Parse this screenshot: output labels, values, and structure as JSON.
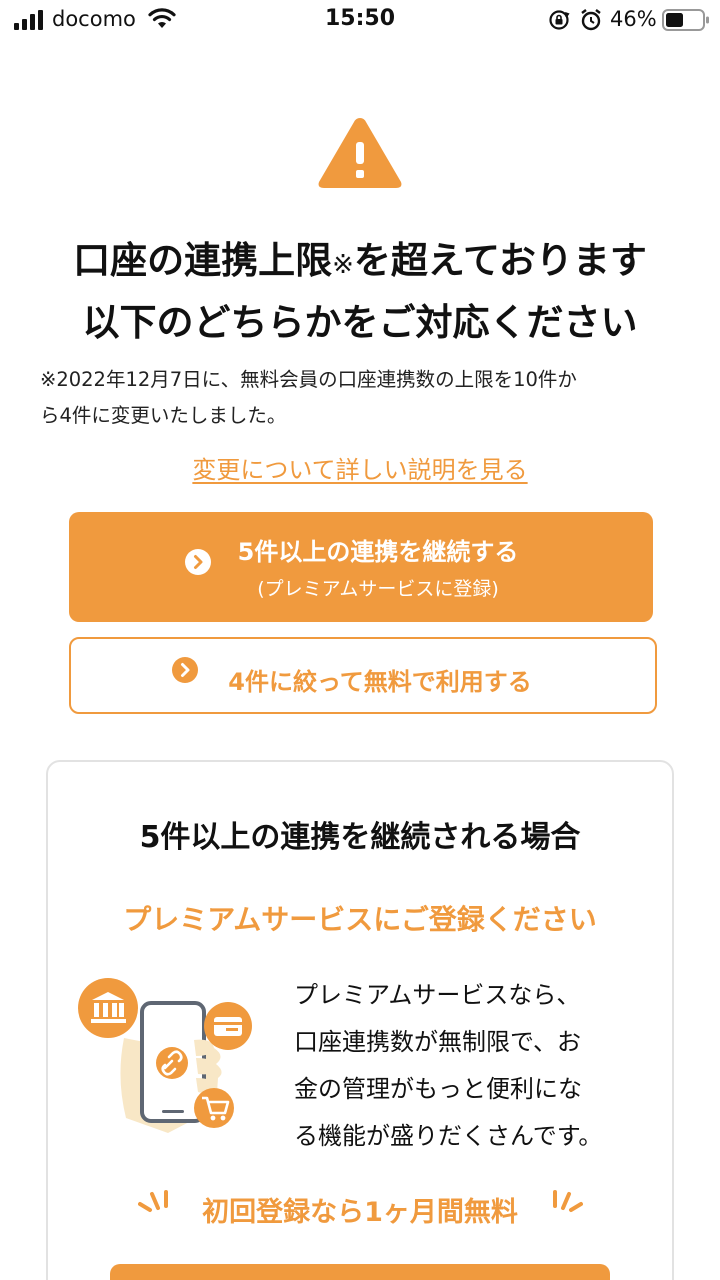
{
  "status_bar": {
    "carrier": "docomo",
    "time": "15:50",
    "battery_percent": "46%",
    "icons": [
      "signal-icon",
      "wifi-icon",
      "orientation-lock-icon",
      "alarm-icon",
      "battery-icon"
    ]
  },
  "alert": {
    "icon": "warning-icon",
    "headline_line1_a": "口座の連携上限",
    "headline_mark": "※",
    "headline_line1_b": "を超えております",
    "headline_line2": "以下のどちらかをご対応ください",
    "note_line1": "※2022年12月7日に、無料会員の口座連携数の上限を10件か",
    "note_line2": "ら4件に変更いたしました。",
    "detail_link": "変更について詳しい説明を見る"
  },
  "actions": {
    "premium_button_label": "5件以上の連携を継続する",
    "premium_button_sub": "(プレミアムサービスに登録)",
    "free_button_label": "4件に絞って無料で利用する"
  },
  "premium_card": {
    "title": "5件以上の連携を継続される場合",
    "subtitle": "プレミアムサービスにご登録ください",
    "body_lines": [
      "プレミアムサービスなら、",
      "口座連携数が無制限で、お",
      "金の管理がもっと便利にな",
      "る機能が盛りだくさんです。"
    ],
    "campaign": "初回登録なら1ヶ月間無料",
    "illustration_icons": [
      "bank-icon",
      "phone-icon",
      "card-icon",
      "link-icon",
      "cart-icon"
    ]
  },
  "colors": {
    "accent": "#f09a3e",
    "text": "#111111",
    "border": "#e2e2e2"
  }
}
